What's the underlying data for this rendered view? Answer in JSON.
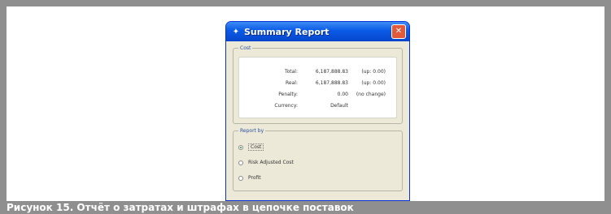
{
  "dialog": {
    "title": "Summary Report",
    "cost_group": {
      "label": "Cost",
      "rows": [
        {
          "label": "Total:",
          "value": "6,187,888.83",
          "change": "(up: 0.00)"
        },
        {
          "label": "Real:",
          "value": "6,187,888.83",
          "change": "(up: 0.00)"
        },
        {
          "label": "Penalty:",
          "value": "0.00",
          "change": "(no change)"
        },
        {
          "label": "Currency:",
          "value": "Default",
          "change": ""
        }
      ]
    },
    "report_by": {
      "label": "Report by",
      "options": [
        {
          "label": "Cost",
          "checked": true
        },
        {
          "label": "Risk Adjusted Cost",
          "checked": false
        },
        {
          "label": "Profit",
          "checked": false
        }
      ]
    }
  },
  "caption": "Рисунок 15. Отчёт о затратах и штрафах в цепочке поставок"
}
